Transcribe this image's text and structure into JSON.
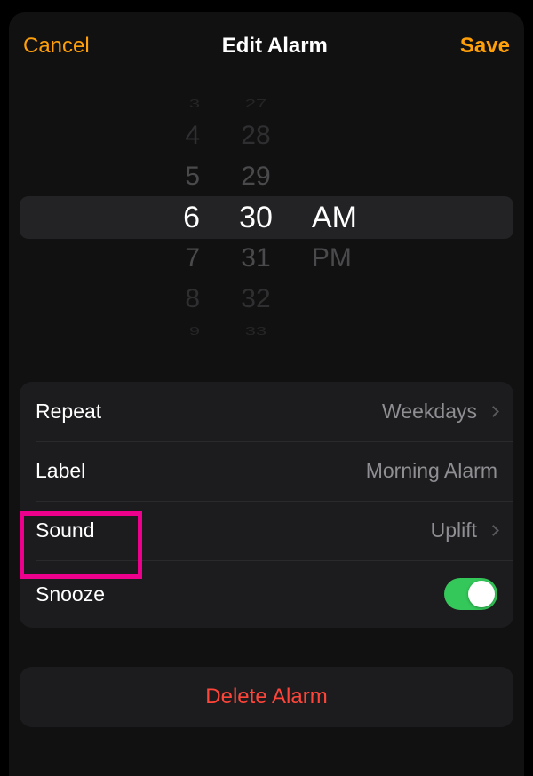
{
  "nav": {
    "cancel": "Cancel",
    "title": "Edit Alarm",
    "save": "Save"
  },
  "picker": {
    "hours": [
      "3",
      "4",
      "5",
      "6",
      "7",
      "8",
      "9"
    ],
    "minutes": [
      "27",
      "28",
      "29",
      "30",
      "31",
      "32",
      "33"
    ],
    "ampm": {
      "am": "AM",
      "pm": "PM"
    }
  },
  "settings": {
    "repeat": {
      "label": "Repeat",
      "value": "Weekdays"
    },
    "label": {
      "label": "Label",
      "value": "Morning Alarm"
    },
    "sound": {
      "label": "Sound",
      "value": "Uplift"
    },
    "snooze": {
      "label": "Snooze"
    }
  },
  "delete": {
    "label": "Delete Alarm"
  },
  "colors": {
    "accent": "#ff9f0a",
    "destructive": "#ff453a",
    "toggleOn": "#34c759"
  }
}
